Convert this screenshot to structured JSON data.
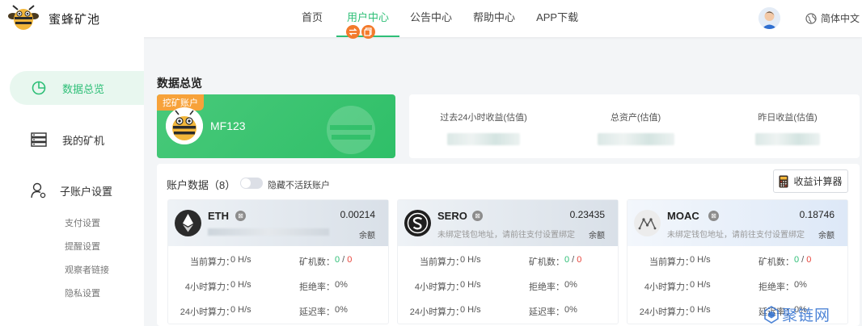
{
  "header": {
    "brand": "蜜蜂矿池",
    "nav": [
      "首页",
      "用户中心",
      "公告中心",
      "帮助中心",
      "APP下载"
    ],
    "active_nav": "用户中心",
    "language": "简体中文"
  },
  "sidebar": {
    "items": [
      {
        "label": "数据总览",
        "icon": "pie-chart-icon",
        "active": true
      },
      {
        "label": "我的矿机",
        "icon": "server-icon",
        "active": false
      },
      {
        "label": "子账户设置",
        "icon": "user-settings-icon",
        "active": false
      }
    ],
    "sub_items": [
      "支付设置",
      "提醒设置",
      "观察者链接",
      "隐私设置"
    ]
  },
  "overview": {
    "title": "数据总览",
    "mining_account": {
      "tag": "挖矿账户",
      "name": "MF123"
    },
    "stats": [
      {
        "label": "过去24小时收益(估值)"
      },
      {
        "label": "总资产(估值)"
      },
      {
        "label": "昨日收益(估值)"
      }
    ]
  },
  "accounts": {
    "title": "账户数据（8）",
    "toggle_label": "隐藏不活跃账户",
    "calc_button": "收益计算器",
    "coins": [
      {
        "name": "ETH",
        "value": "0.00214",
        "balance_label": "余额",
        "address": "",
        "hashrate_label": "当前算力：",
        "hashrate": "0 H/s",
        "miners_label": "矿机数：",
        "miners_online": "0",
        "miners_offline": "0",
        "h4_label": "4小时算力：",
        "h4": "0 H/s",
        "reject_label": "拒绝率：",
        "reject": "0%",
        "h24_label": "24小时算力：",
        "h24": "0 H/s",
        "delay_label": "延迟率：",
        "delay": "0%"
      },
      {
        "name": "SERO",
        "value": "0.23435",
        "balance_label": "余额",
        "address": "未绑定钱包地址，请前往支付设置绑定",
        "hashrate_label": "当前算力：",
        "hashrate": "0 H/s",
        "miners_label": "矿机数：",
        "miners_online": "0",
        "miners_offline": "0",
        "h4_label": "4小时算力：",
        "h4": "0 H/s",
        "reject_label": "拒绝率：",
        "reject": "0%",
        "h24_label": "24小时算力：",
        "h24": "0 H/s",
        "delay_label": "延迟率：",
        "delay": "0%"
      },
      {
        "name": "MOAC",
        "value": "0.18746",
        "balance_label": "余额",
        "address": "未绑定钱包地址，请前往支付设置绑定",
        "hashrate_label": "当前算力：",
        "hashrate": "0 H/s",
        "miners_label": "矿机数：",
        "miners_online": "0",
        "miners_offline": "0",
        "h4_label": "4小时算力：",
        "h4": "0 H/s",
        "reject_label": "拒绝率：",
        "reject": "0%",
        "h24_label": "24小时算力：",
        "h24": "0 H/s",
        "delay_label": "延迟率：",
        "delay": "0%"
      }
    ]
  },
  "watermark": "聚链网",
  "colors": {
    "accent": "#2ebf77",
    "orange": "#f7a23a",
    "red": "#e8453c"
  }
}
